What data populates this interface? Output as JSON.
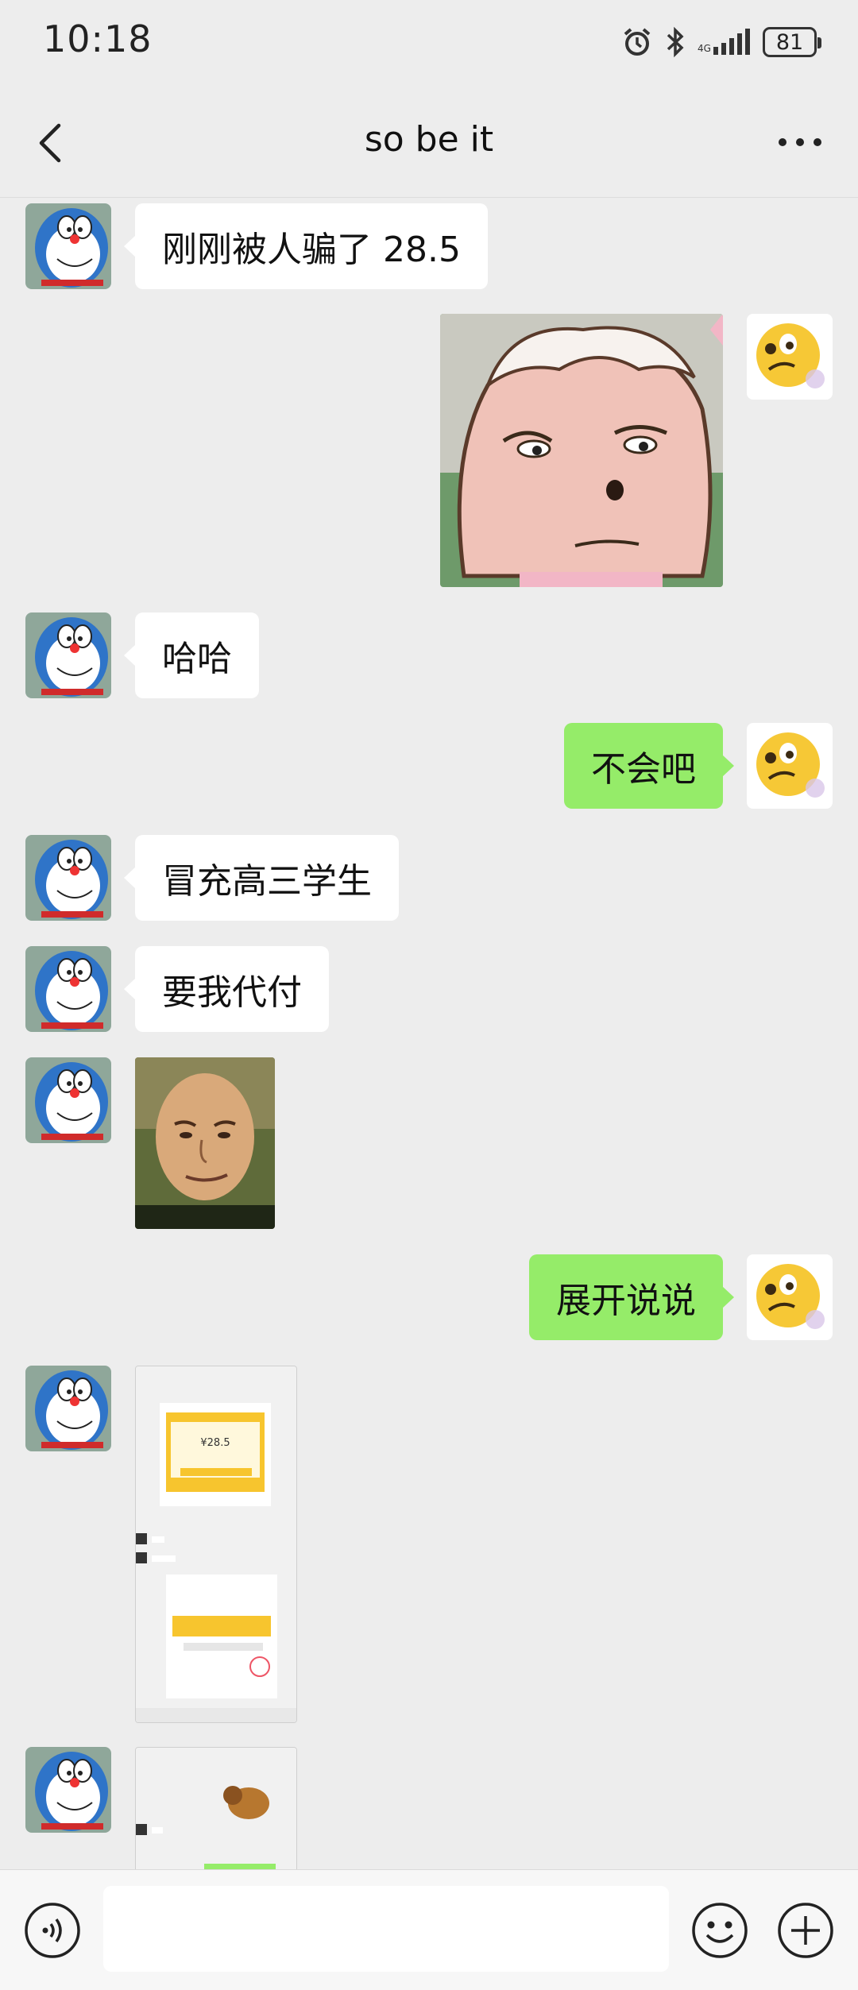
{
  "status_bar": {
    "time": "10:18",
    "battery": "81"
  },
  "header": {
    "title": "so be it"
  },
  "messages": [
    {
      "side": "left",
      "type": "text",
      "text": "刚刚被人骗了 28.5"
    },
    {
      "side": "right",
      "type": "sticker"
    },
    {
      "side": "left",
      "type": "text",
      "text": "哈哈"
    },
    {
      "side": "right",
      "type": "text",
      "text": "不会吧"
    },
    {
      "side": "left",
      "type": "text",
      "text": "冒充高三学生"
    },
    {
      "side": "left",
      "type": "text",
      "text": "要我代付"
    },
    {
      "side": "left",
      "type": "image"
    },
    {
      "side": "right",
      "type": "text",
      "text": "展开说说"
    },
    {
      "side": "left",
      "type": "screenshot"
    },
    {
      "side": "left",
      "type": "screenshot"
    }
  ],
  "screenshot_1": {
    "amount": "¥28.5"
  },
  "input": {
    "value": ""
  },
  "colors": {
    "background": "#ededed",
    "own_bubble": "#95ec69",
    "other_bubble": "#ffffff",
    "input_bar": "#f7f7f7"
  },
  "icons": [
    "back-arrow-icon",
    "more-dots-icon",
    "voice-icon",
    "emoji-icon",
    "plus-icon",
    "alarm-icon",
    "bluetooth-icon",
    "signal-icon",
    "battery-icon"
  ]
}
